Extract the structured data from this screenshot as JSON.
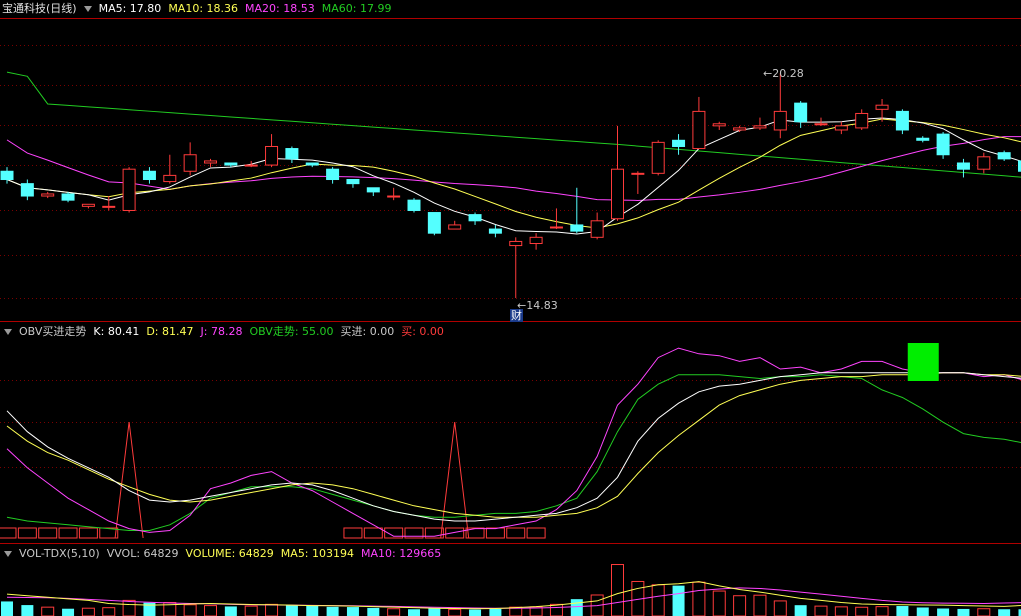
{
  "colors": {
    "up": "#ff3b3b",
    "down": "#54ffff",
    "ma5": "#ffffff",
    "ma10": "#ffff55",
    "ma20": "#ff44ff",
    "ma60": "#22cc22",
    "frame": "#b00000",
    "grid": "#7a0000"
  },
  "main": {
    "title": "宝通科技(日线)",
    "ma5": "MA5: 17.80",
    "ma10": "MA10: 18.36",
    "ma20": "MA20: 18.53",
    "ma60": "MA60: 17.99",
    "high_label": "20.28",
    "low_label": "14.83",
    "event_badge": "财",
    "candles": [
      [
        17.9,
        17.7,
        18.0,
        17.6
      ],
      [
        17.6,
        17.3,
        17.7,
        17.2
      ],
      [
        17.3,
        17.35,
        17.4,
        17.25
      ],
      [
        17.35,
        17.2,
        17.4,
        17.15
      ],
      [
        17.05,
        17.1,
        17.1,
        17.0
      ],
      [
        17.05,
        17.05,
        17.3,
        16.95
      ],
      [
        16.95,
        17.95,
        18.0,
        16.9
      ],
      [
        17.9,
        17.7,
        18.0,
        17.6
      ],
      [
        17.65,
        17.8,
        18.3,
        17.6
      ],
      [
        17.9,
        18.3,
        18.6,
        17.8
      ],
      [
        18.1,
        18.15,
        18.2,
        18.0
      ],
      [
        18.1,
        18.05,
        18.1,
        18.0
      ],
      [
        18.05,
        18.05,
        18.15,
        18.0
      ],
      [
        18.05,
        18.5,
        18.8,
        18.0
      ],
      [
        18.45,
        18.2,
        18.5,
        18.1
      ],
      [
        18.1,
        18.05,
        18.1,
        18.0
      ],
      [
        17.95,
        17.7,
        18.0,
        17.6
      ],
      [
        17.7,
        17.6,
        17.7,
        17.5
      ],
      [
        17.5,
        17.4,
        17.5,
        17.3
      ],
      [
        17.3,
        17.3,
        17.5,
        17.2
      ],
      [
        17.2,
        16.95,
        17.25,
        16.9
      ],
      [
        16.9,
        16.4,
        16.9,
        16.35
      ],
      [
        16.5,
        16.6,
        16.7,
        16.5
      ],
      [
        16.85,
        16.7,
        16.9,
        16.6
      ],
      [
        16.5,
        16.4,
        16.6,
        16.3
      ],
      [
        16.1,
        16.2,
        16.3,
        14.83
      ],
      [
        16.15,
        16.3,
        16.4,
        16.0
      ],
      [
        16.55,
        16.55,
        17.0,
        16.5
      ],
      [
        16.6,
        16.45,
        17.5,
        16.4
      ],
      [
        16.3,
        16.7,
        16.9,
        16.25
      ],
      [
        16.75,
        17.95,
        19.0,
        16.7
      ],
      [
        17.85,
        17.85,
        17.9,
        17.35
      ],
      [
        17.85,
        18.6,
        18.65,
        17.8
      ],
      [
        18.65,
        18.5,
        18.8,
        18.3
      ],
      [
        18.45,
        19.35,
        19.7,
        18.45
      ],
      [
        19.0,
        19.05,
        19.1,
        18.9
      ],
      [
        18.9,
        18.95,
        19.0,
        18.85
      ],
      [
        18.95,
        19.0,
        19.2,
        18.9
      ],
      [
        18.9,
        19.35,
        20.28,
        18.7
      ],
      [
        19.55,
        19.1,
        19.6,
        18.95
      ],
      [
        19.05,
        19.05,
        19.2,
        19.0
      ],
      [
        18.9,
        19.0,
        19.1,
        18.8
      ],
      [
        18.95,
        19.3,
        19.4,
        18.9
      ],
      [
        19.4,
        19.5,
        19.65,
        19.1
      ],
      [
        19.35,
        18.9,
        19.4,
        18.8
      ],
      [
        18.7,
        18.65,
        18.75,
        18.6
      ],
      [
        18.8,
        18.3,
        18.85,
        18.2
      ],
      [
        18.1,
        17.95,
        18.2,
        17.75
      ],
      [
        17.95,
        18.25,
        18.35,
        17.85
      ],
      [
        18.35,
        18.2,
        18.4,
        18.15
      ],
      [
        18.15,
        17.9,
        18.2,
        17.7
      ]
    ]
  },
  "obv": {
    "title": "OBV买进走势",
    "k": "K: 80.41",
    "d": "D: 81.47",
    "j": "J: 78.28",
    "trend": "OBV走势: 55.00",
    "buy": "买进: 0.00",
    "sell": "买: 0.00",
    "k_vals": [
      68,
      57,
      49,
      43,
      38,
      33,
      26,
      21,
      20,
      21,
      23,
      25,
      27,
      29,
      30,
      29,
      26,
      22,
      18,
      15,
      13,
      11,
      10,
      10,
      11,
      12,
      13,
      14,
      17,
      22,
      33,
      52,
      64,
      72,
      78,
      81,
      82,
      84,
      86,
      87,
      88,
      88,
      88,
      88,
      88,
      88,
      88,
      88,
      87,
      86,
      85
    ],
    "d_vals": [
      60,
      52,
      46,
      42,
      37,
      32,
      28,
      24,
      21,
      20,
      21,
      23,
      25,
      27,
      29,
      30,
      29,
      27,
      24,
      21,
      18,
      16,
      14,
      13,
      12,
      12,
      12,
      13,
      14,
      17,
      23,
      35,
      46,
      55,
      63,
      71,
      76,
      79,
      82,
      84,
      85,
      86,
      86,
      87,
      87,
      87,
      88,
      88,
      87,
      87,
      86
    ],
    "j_vals": [
      48,
      38,
      30,
      22,
      16,
      10,
      6,
      4,
      5,
      13,
      27,
      30,
      34,
      36,
      30,
      26,
      20,
      14,
      8,
      2,
      2,
      2,
      4,
      6,
      6,
      8,
      10,
      16,
      26,
      44,
      71,
      82,
      96,
      101,
      98,
      97,
      94,
      96,
      90,
      91,
      88,
      90,
      94,
      94,
      90,
      88,
      88,
      88,
      86,
      87,
      84
    ],
    "trend_vals": [
      12,
      10,
      9,
      8,
      7,
      6,
      5,
      5,
      8,
      14,
      22,
      25,
      28,
      28,
      28,
      27,
      24,
      21,
      18,
      15,
      13,
      12,
      12,
      13,
      14,
      14,
      15,
      18,
      22,
      36,
      57,
      74,
      82,
      87,
      87,
      87,
      86,
      85,
      86,
      86,
      87,
      86,
      85,
      79,
      75,
      69,
      62,
      56,
      54,
      53,
      51
    ],
    "spikes": [
      6,
      22
    ],
    "bars": [
      0,
      1,
      2,
      3,
      4,
      5,
      17,
      18,
      19,
      20,
      21,
      22,
      23,
      24,
      25,
      26
    ],
    "green_box_index": 45
  },
  "vol": {
    "title": "VOL-TDX(5,10)",
    "vvol": "VVOL: 64829",
    "volume": "VOLUME: 64829",
    "ma5": "MA5: 103194",
    "ma10": "MA10: 129665",
    "values": [
      140000,
      105000,
      85000,
      70000,
      75000,
      80000,
      150000,
      128000,
      130000,
      108000,
      100000,
      92000,
      95000,
      112000,
      105000,
      96000,
      88000,
      86000,
      78000,
      70000,
      65000,
      72000,
      64000,
      62000,
      68000,
      85000,
      88000,
      112000,
      162000,
      202000,
      495000,
      332000,
      300000,
      292000,
      325000,
      240000,
      195000,
      200000,
      145000,
      104000,
      95000,
      88000,
      84000,
      90000,
      96000,
      82000,
      72000,
      68000,
      70000,
      65000,
      64829
    ],
    "ma5_vals": [
      210000,
      195000,
      180000,
      165000,
      150000,
      120000,
      110000,
      105000,
      108000,
      115000,
      120000,
      115000,
      110000,
      108000,
      104000,
      100000,
      98000,
      95000,
      90000,
      85000,
      80000,
      75000,
      72000,
      70000,
      72000,
      80000,
      90000,
      105000,
      125000,
      145000,
      215000,
      265000,
      300000,
      310000,
      330000,
      290000,
      255000,
      230000,
      200000,
      170000,
      150000,
      130000,
      115000,
      110000,
      108000,
      106000,
      104000,
      100000,
      96000,
      92000,
      103194
    ],
    "ma10_vals": [
      180000,
      178000,
      175000,
      170000,
      160000,
      150000,
      140000,
      132000,
      125000,
      120000,
      118000,
      112000,
      108000,
      106000,
      104000,
      102000,
      100000,
      98000,
      95000,
      92000,
      88000,
      84000,
      80000,
      77000,
      75000,
      75000,
      77000,
      82000,
      90000,
      100000,
      130000,
      160000,
      190000,
      215000,
      245000,
      260000,
      270000,
      265000,
      250000,
      230000,
      210000,
      190000,
      170000,
      150000,
      135000,
      128000,
      124000,
      122000,
      120000,
      125000,
      129665
    ]
  }
}
